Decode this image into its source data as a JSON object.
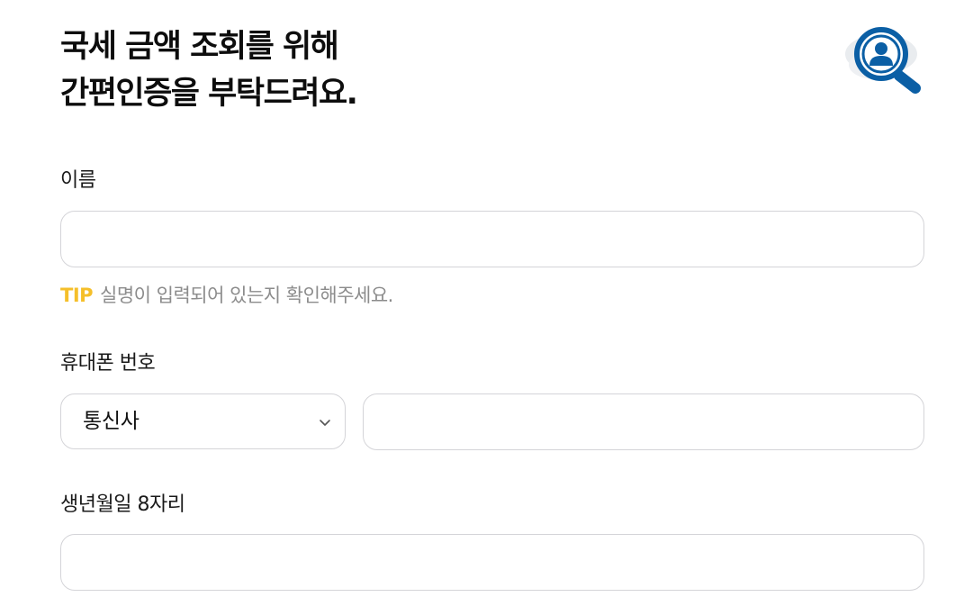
{
  "header": {
    "title_line1": "국세 금액 조회를 위해",
    "title_line2": "간편인증을 부탁드려요.",
    "icon": "user-search-icon"
  },
  "form": {
    "name": {
      "label": "이름",
      "value": "",
      "placeholder": ""
    },
    "tip": {
      "tag": "TIP",
      "text": "실명이 입력되어 있는지 확인해주세요."
    },
    "phone": {
      "label": "휴대폰 번호",
      "carrier_selected": "통신사",
      "number_value": "",
      "number_placeholder": ""
    },
    "birth": {
      "label": "생년월일 8자리",
      "value": "",
      "placeholder": ""
    }
  },
  "colors": {
    "accent_tip": "#f5bf2a",
    "icon_blue": "#0b5fa5",
    "border": "#d4d4d8",
    "text_muted": "#8c8c8c"
  }
}
